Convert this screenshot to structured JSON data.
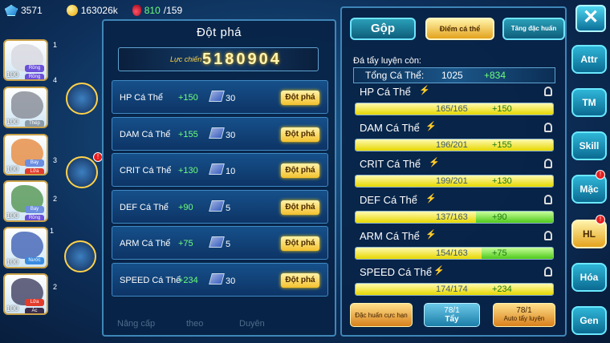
{
  "topbar": {
    "gems": "3571",
    "gold": "163026k",
    "stamina_current": "810",
    "stamina_max": "/159"
  },
  "team": [
    {
      "level": "100",
      "tag1": "Rồng",
      "tag2": "Rồng",
      "rank": "1"
    },
    {
      "level": "100",
      "tag1": "Thép",
      "rank": "4"
    },
    {
      "level": "100",
      "tag1": "Bay",
      "tag2": "Lửa",
      "rank": "3"
    },
    {
      "level": "100",
      "tag1": "Bay",
      "tag2": "Rồng",
      "rank": "2"
    },
    {
      "level": "100",
      "tag1": "Nước",
      "rank": "1"
    },
    {
      "level": "100",
      "tag1": "Lửa",
      "tag2": "Ác",
      "rank": "2"
    }
  ],
  "breakthrough": {
    "title": "Đột phá",
    "force_label": "Lực chiến",
    "force_value": "5180904",
    "rows": [
      {
        "name": "HP Cá Thể",
        "bonus": "+150",
        "cost": "30",
        "button": "Đột phá"
      },
      {
        "name": "DAM Cá Thể",
        "bonus": "+155",
        "cost": "30",
        "button": "Đột phá"
      },
      {
        "name": "CRIT Cá Thể",
        "bonus": "+130",
        "cost": "10",
        "button": "Đột phá"
      },
      {
        "name": "DEF Cá Thể",
        "bonus": "+90",
        "cost": "5",
        "button": "Đột phá"
      },
      {
        "name": "ARM Cá Thể",
        "bonus": "+75",
        "cost": "5",
        "button": "Đột phá"
      },
      {
        "name": "SPEED Cá Thể",
        "bonus": "+234",
        "cost": "30",
        "button": "Đột phá"
      }
    ]
  },
  "right_panel": {
    "tabs": {
      "merge": "Gộp",
      "individual_points": "Điểm cá thể",
      "special_train": "Tăng đặc huấn"
    },
    "remaining_label": "Đá tẩy luyện còn:",
    "total_label": "Tổng Cá Thể:",
    "total_value": "1025",
    "total_plus": "+834",
    "stats": [
      {
        "name": "HP Cá Thể",
        "text": "165/165",
        "plus": "+150",
        "fill": 1.0,
        "green_fill": 0
      },
      {
        "name": "DAM Cá Thể",
        "text": "196/201",
        "plus": "+155",
        "fill": 1.0,
        "green_fill": 0
      },
      {
        "name": "CRIT Cá Thể",
        "text": "199/201",
        "plus": "+130",
        "fill": 1.0,
        "green_fill": 0
      },
      {
        "name": "DEF Cá Thể",
        "text": "137/163",
        "plus": "+90",
        "fill": 0.61,
        "green_fill": 0.39
      },
      {
        "name": "ARM Cá Thể",
        "text": "154/163",
        "plus": "+75",
        "fill": 0.64,
        "green_fill": 0.36
      },
      {
        "name": "SPEED Cá Thể",
        "text": "174/174",
        "plus": "+234",
        "fill": 1.0,
        "green_fill": 0
      }
    ],
    "bottom": {
      "special_limit": "Đặc huấn cực hạn",
      "wash_count": "78/1",
      "wash": "Tẩy",
      "auto_count": "78/1",
      "auto": "Auto tẩy luyện"
    }
  },
  "side_menu": [
    "Attr",
    "TM",
    "Skill",
    "Mặc",
    "HL",
    "Hóa",
    "Gen"
  ],
  "background_labels": [
    "Nâng cấp",
    "theo",
    "Duyên"
  ]
}
